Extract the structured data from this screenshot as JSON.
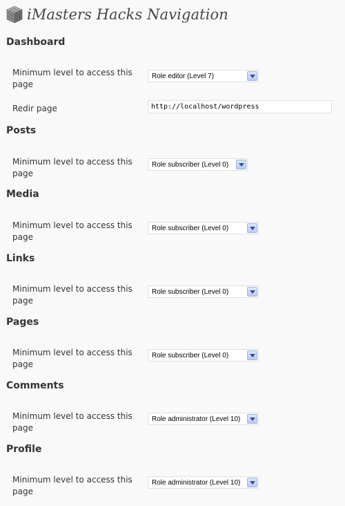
{
  "header": {
    "title": "iMasters Hacks Navigation",
    "icon": "grid-cube-icon"
  },
  "sections": [
    {
      "title": "Dashboard",
      "min_level_label": "Minimum level to access this page",
      "select_value": "Role editor (Level 7)",
      "redir_label": "Redir page",
      "redir_value": "http://localhost/wordpress"
    },
    {
      "title": "Posts",
      "min_level_label": "Minimum level to access this page",
      "select_value": "Role subscriber (Level 0)"
    },
    {
      "title": "Media",
      "min_level_label": "Minimum level to access this page",
      "select_value": "Role subscriber (Level 0)"
    },
    {
      "title": "Links",
      "min_level_label": "Minimum level to access this page",
      "select_value": "Role subscriber (Level 0)"
    },
    {
      "title": "Pages",
      "min_level_label": "Minimum level to access this page",
      "select_value": "Role subscriber (Level 0)"
    },
    {
      "title": "Comments",
      "min_level_label": "Minimum level to access this page",
      "select_value": "Role administrator (Level 10)"
    },
    {
      "title": "Profile",
      "min_level_label": "Minimum level to access this page",
      "select_value": "Role administrator (Level 10)"
    }
  ]
}
